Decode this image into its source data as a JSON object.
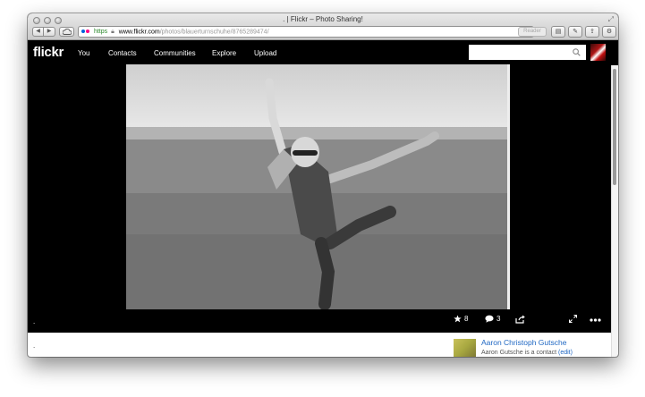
{
  "window": {
    "title": ". | Flickr – Photo Sharing!",
    "url": {
      "scheme": "https",
      "host": "www.flickr.com",
      "path": "/photos/blauerturnschuhe/8765289474/"
    },
    "reader_label": "Reader"
  },
  "flickr": {
    "logo": "flickr",
    "nav": [
      "You",
      "Contacts",
      "Communities",
      "Explore",
      "Upload"
    ],
    "search": {
      "placeholder": "",
      "value": ""
    }
  },
  "photo": {
    "title": ".",
    "faves": "8",
    "comments": "3"
  },
  "info": {
    "description": ".",
    "contact": {
      "name": "Aaron Christoph Gutsche",
      "note": "Aaron Gutsche is a contact",
      "note_link": "(edit)"
    }
  },
  "colors": {
    "flickr_blue": "#0063dc",
    "flickr_pink": "#ff0084",
    "link": "#1f67c3"
  },
  "icons": [
    "back-icon",
    "forward-icon",
    "icloud-icon",
    "lock-icon",
    "reload-icon",
    "search-icon",
    "star-icon",
    "comment-icon",
    "share-icon",
    "fullscreen-icon",
    "more-icon"
  ]
}
